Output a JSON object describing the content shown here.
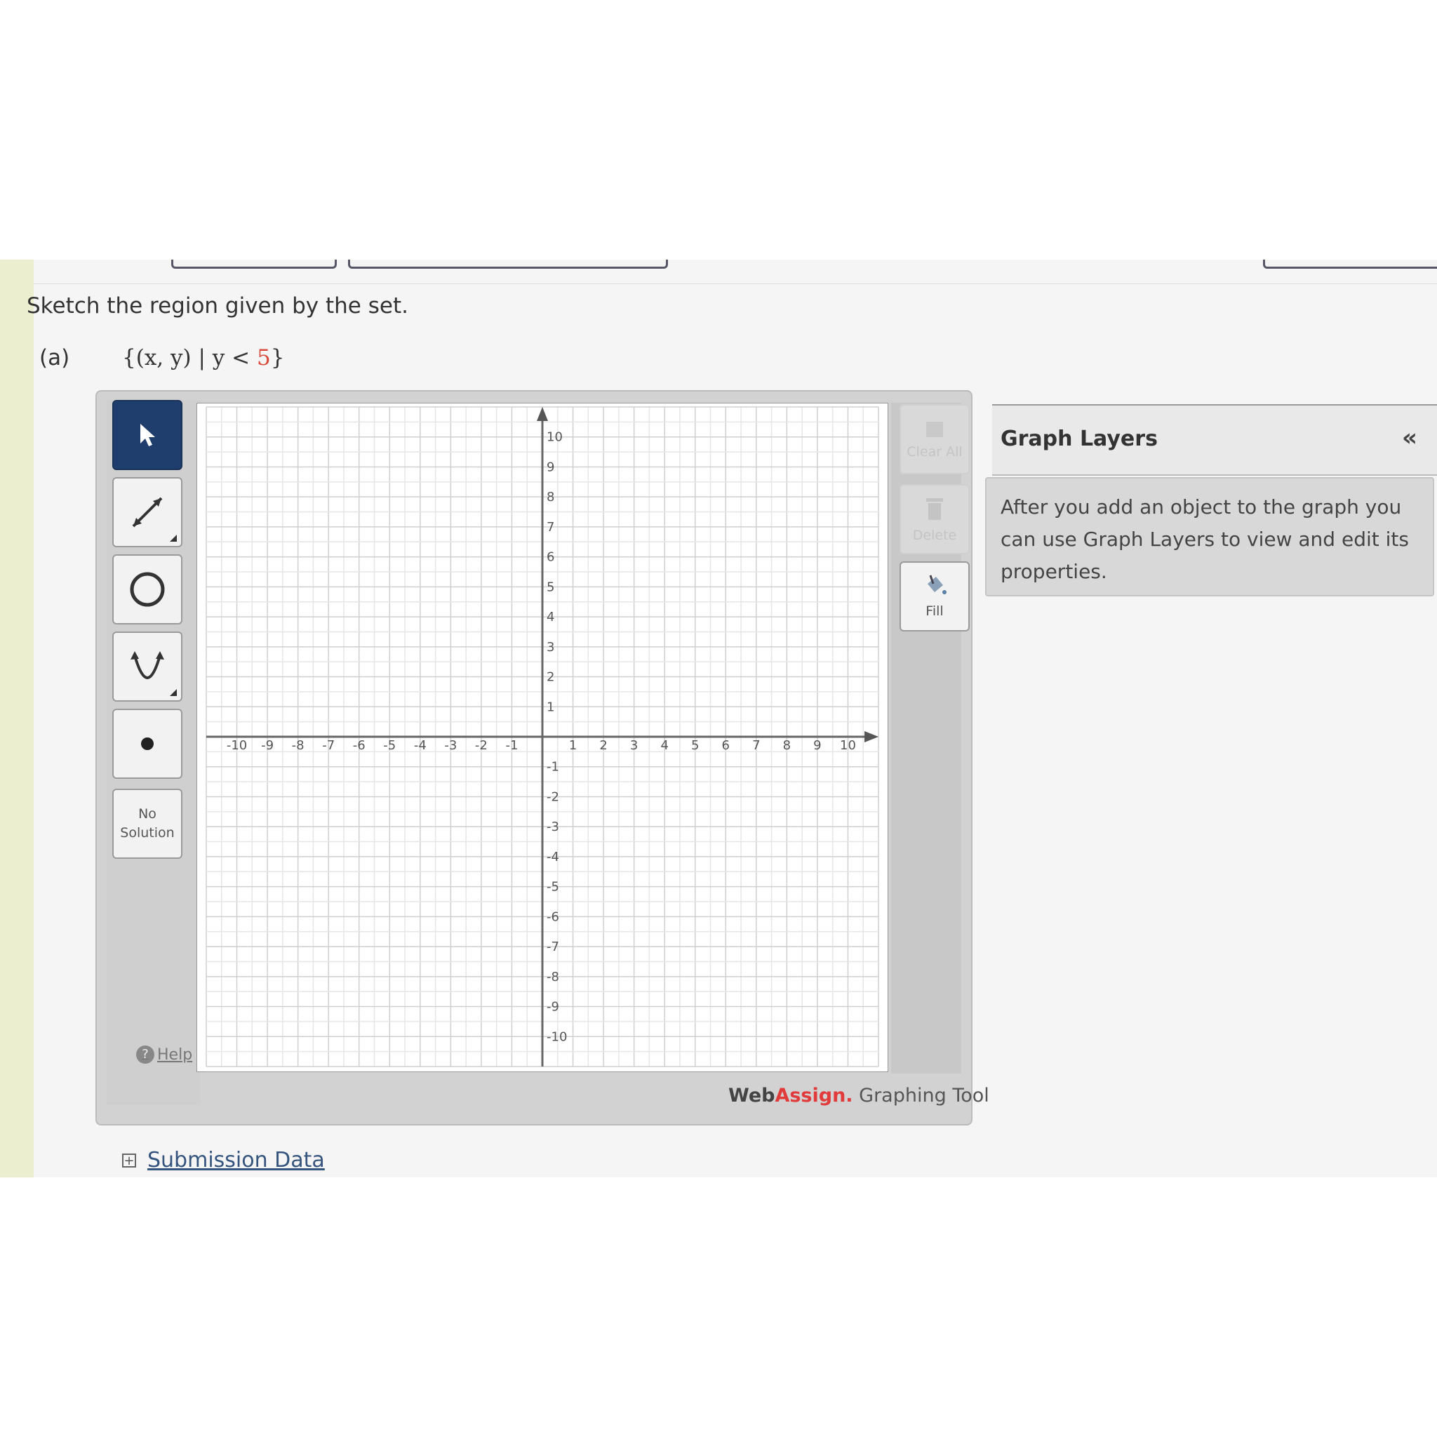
{
  "question": {
    "prompt": "Sketch the region given by the set.",
    "part_label": "(a)",
    "set_prefix": "{(x, y) | y < ",
    "set_value": "5",
    "set_suffix": "}"
  },
  "toolbar": {
    "tools": [
      {
        "name": "pointer",
        "icon": "arrow-pointer-icon",
        "active": true
      },
      {
        "name": "line",
        "icon": "line-icon",
        "active": false
      },
      {
        "name": "circle",
        "icon": "circle-icon",
        "active": false
      },
      {
        "name": "parabola",
        "icon": "parabola-icon",
        "active": false
      },
      {
        "name": "point",
        "icon": "point-icon",
        "active": false
      }
    ],
    "no_solution_line1": "No",
    "no_solution_line2": "Solution",
    "help_label": "Help"
  },
  "graph": {
    "x_range": [
      -10,
      10
    ],
    "y_range": [
      -10,
      10
    ],
    "x_ticks": [
      "-10",
      "-9",
      "-8",
      "-7",
      "-6",
      "-5",
      "-4",
      "-3",
      "-2",
      "-1",
      "1",
      "2",
      "3",
      "4",
      "5",
      "6",
      "7",
      "8",
      "9",
      "10"
    ],
    "y_ticks": [
      "10",
      "9",
      "8",
      "7",
      "6",
      "5",
      "4",
      "3",
      "2",
      "1",
      "-1",
      "-2",
      "-3",
      "-4",
      "-5",
      "-6",
      "-7",
      "-8",
      "-9",
      "-10"
    ],
    "grid": true
  },
  "right_tools": {
    "clear_all": "Clear All",
    "delete": "Delete",
    "fill": "Fill"
  },
  "branding": {
    "web": "Web",
    "assign": "Assign.",
    "tool": " Graphing Tool"
  },
  "layers": {
    "title": "Graph Layers",
    "collapse": "«",
    "body": "After you add an object to the graph you can use Graph Layers to view and edit its properties."
  },
  "submission": {
    "label": "Submission Data"
  }
}
